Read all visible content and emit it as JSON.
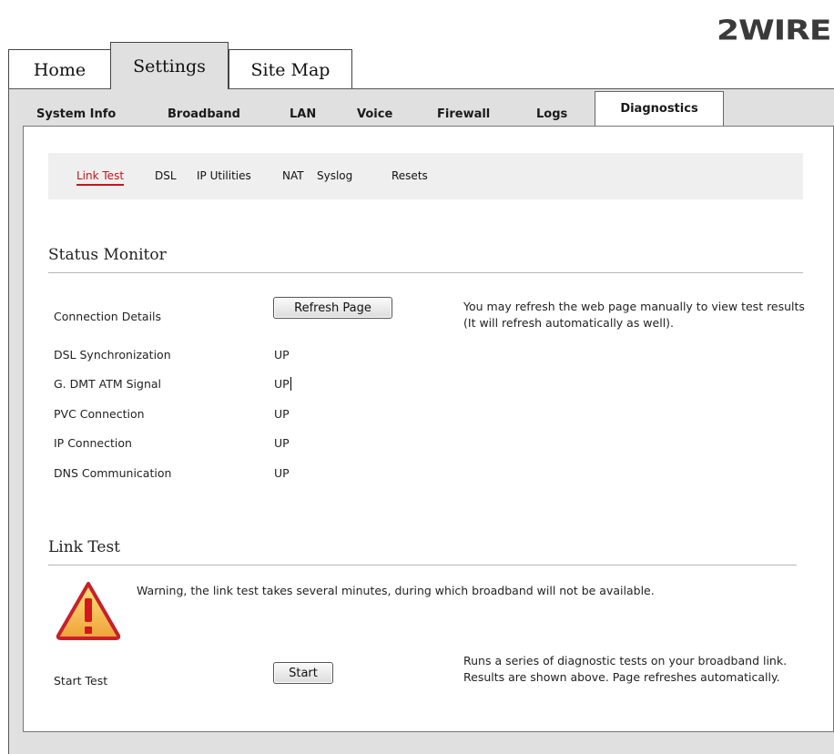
{
  "brand": {
    "logo_text": "2WIRE"
  },
  "top_tabs": [
    {
      "label": "Home"
    },
    {
      "label": "Settings"
    },
    {
      "label": "Site Map"
    }
  ],
  "sub_tabs": [
    {
      "label": "System Info"
    },
    {
      "label": "Broadband"
    },
    {
      "label": "LAN"
    },
    {
      "label": "Voice"
    },
    {
      "label": "Firewall"
    },
    {
      "label": "Logs"
    },
    {
      "label": "Diagnostics"
    }
  ],
  "utility_nav": [
    {
      "label": "Link Test"
    },
    {
      "label": "DSL"
    },
    {
      "label": "IP Utilities"
    },
    {
      "label": "NAT"
    },
    {
      "label": "Syslog"
    },
    {
      "label": "Resets"
    }
  ],
  "status_monitor": {
    "title": "Status Monitor",
    "connection_label": "Connection Details",
    "refresh_button": "Refresh Page",
    "refresh_note": "You may refresh the web page manually to view test results (It will refresh automatically as well).",
    "rows": [
      {
        "label": "DSL Synchronization",
        "value": "UP"
      },
      {
        "label": "G. DMT ATM Signal",
        "value": "UP"
      },
      {
        "label": "PVC Connection",
        "value": "UP"
      },
      {
        "label": "IP Connection",
        "value": "UP"
      },
      {
        "label": "DNS Communication",
        "value": "UP"
      }
    ]
  },
  "link_test": {
    "title": "Link Test",
    "warning": "Warning, the link test takes several minutes, during which broadband will not be available.",
    "start_label": "Start Test",
    "start_button": "Start",
    "start_note": "Runs a series of diagnostic tests on your broadband link. Results are shown above. Page refreshes automatically."
  },
  "colors": {
    "accent": "#c5161d",
    "frame_bg": "#e0e0e0",
    "warning_fill": "#f0a23a"
  }
}
